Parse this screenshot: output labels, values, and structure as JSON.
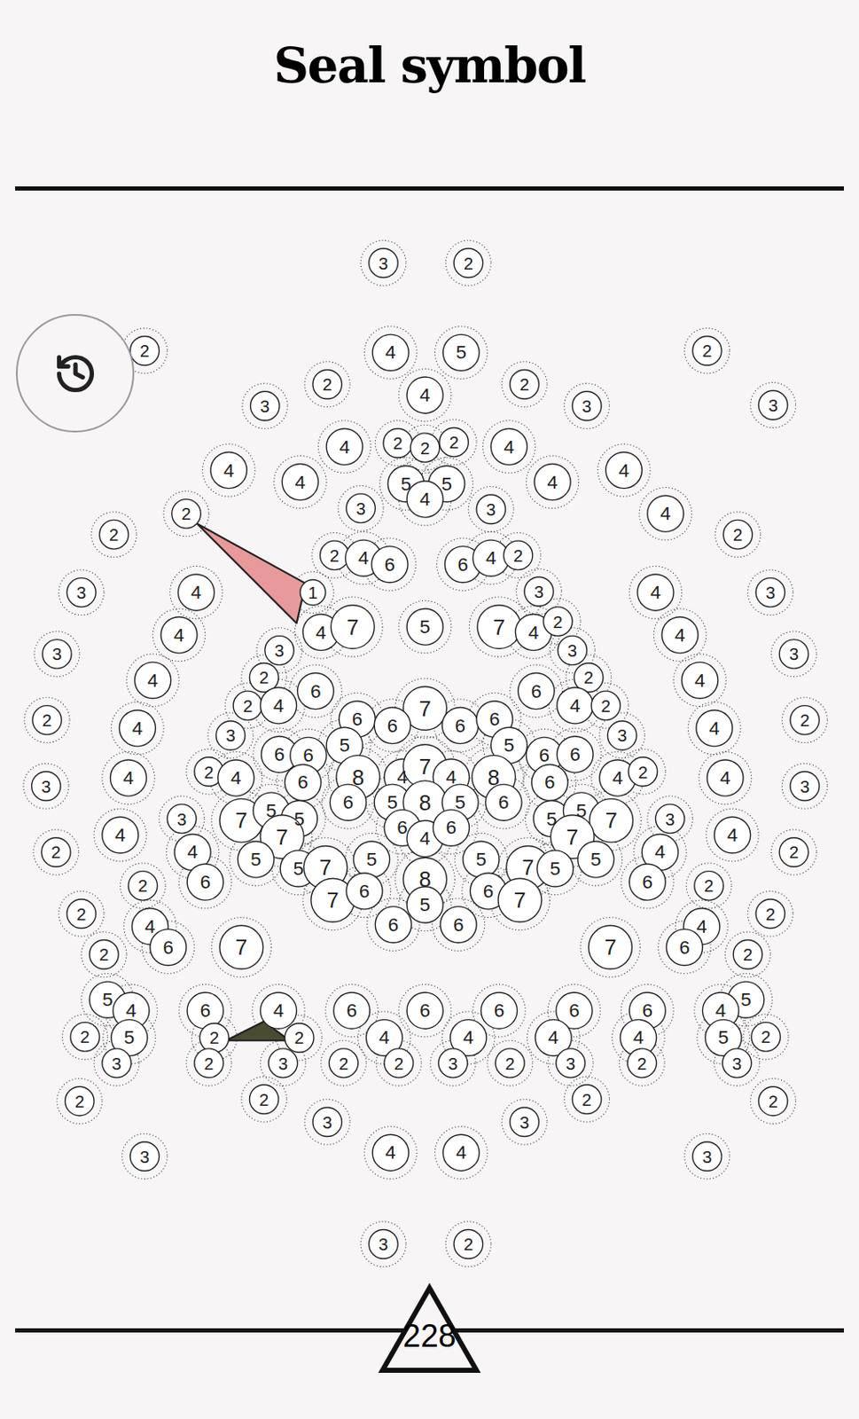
{
  "title": "Seal symbol",
  "score": "228",
  "circles": [
    {
      "value": "3"
    },
    {
      "value": "2"
    },
    {
      "value": "2"
    },
    {
      "value": "4"
    },
    {
      "value": "5"
    },
    {
      "value": "2"
    },
    {
      "value": "3"
    },
    {
      "value": "3"
    },
    {
      "value": "2"
    },
    {
      "value": "4"
    },
    {
      "value": "2"
    },
    {
      "value": "3"
    },
    {
      "value": "3"
    },
    {
      "value": "4"
    },
    {
      "value": "4"
    },
    {
      "value": "4"
    },
    {
      "value": "2"
    },
    {
      "value": "2"
    },
    {
      "value": "2"
    },
    {
      "value": "4"
    },
    {
      "value": "4"
    },
    {
      "value": "4"
    },
    {
      "value": "5"
    },
    {
      "value": "5"
    },
    {
      "value": "4"
    },
    {
      "value": "2"
    },
    {
      "value": "3"
    },
    {
      "value": "3"
    },
    {
      "value": "4"
    },
    {
      "value": "2"
    },
    {
      "value": "2"
    },
    {
      "value": "2"
    },
    {
      "value": "4"
    },
    {
      "value": "6"
    },
    {
      "value": "6"
    },
    {
      "value": "4"
    },
    {
      "value": "2"
    },
    {
      "value": "3"
    },
    {
      "value": "4"
    },
    {
      "value": "1"
    },
    {
      "value": "3"
    },
    {
      "value": "4"
    },
    {
      "value": "3"
    },
    {
      "value": "4"
    },
    {
      "value": "7"
    },
    {
      "value": "5"
    },
    {
      "value": "7"
    },
    {
      "value": "4"
    },
    {
      "value": "2"
    },
    {
      "value": "4"
    },
    {
      "value": "4"
    },
    {
      "value": "3"
    },
    {
      "value": "3"
    },
    {
      "value": "3"
    },
    {
      "value": "3"
    },
    {
      "value": "4"
    },
    {
      "value": "2"
    },
    {
      "value": "6"
    },
    {
      "value": "6"
    },
    {
      "value": "2"
    },
    {
      "value": "4"
    },
    {
      "value": "2"
    },
    {
      "value": "4"
    },
    {
      "value": "4"
    },
    {
      "value": "2"
    },
    {
      "value": "2"
    },
    {
      "value": "7"
    },
    {
      "value": "6"
    },
    {
      "value": "6"
    },
    {
      "value": "6"
    },
    {
      "value": "6"
    },
    {
      "value": "2"
    },
    {
      "value": "4"
    },
    {
      "value": "4"
    },
    {
      "value": "3"
    },
    {
      "value": "5"
    },
    {
      "value": "5"
    },
    {
      "value": "3"
    },
    {
      "value": "6"
    },
    {
      "value": "6"
    },
    {
      "value": "6"
    },
    {
      "value": "6"
    },
    {
      "value": "3"
    },
    {
      "value": "4"
    },
    {
      "value": "2"
    },
    {
      "value": "4"
    },
    {
      "value": "6"
    },
    {
      "value": "8"
    },
    {
      "value": "4"
    },
    {
      "value": "7"
    },
    {
      "value": "4"
    },
    {
      "value": "8"
    },
    {
      "value": "6"
    },
    {
      "value": "4"
    },
    {
      "value": "2"
    },
    {
      "value": "4"
    },
    {
      "value": "3"
    },
    {
      "value": "6"
    },
    {
      "value": "5"
    },
    {
      "value": "8"
    },
    {
      "value": "5"
    },
    {
      "value": "6"
    },
    {
      "value": "3"
    },
    {
      "value": "7"
    },
    {
      "value": "5"
    },
    {
      "value": "5"
    },
    {
      "value": "7"
    },
    {
      "value": "5"
    },
    {
      "value": "5"
    },
    {
      "value": "7"
    },
    {
      "value": "7"
    },
    {
      "value": "3"
    },
    {
      "value": "4"
    },
    {
      "value": "6"
    },
    {
      "value": "4"
    },
    {
      "value": "6"
    },
    {
      "value": "4"
    },
    {
      "value": "2"
    },
    {
      "value": "4"
    },
    {
      "value": "5"
    },
    {
      "value": "5"
    },
    {
      "value": "5"
    },
    {
      "value": "5"
    },
    {
      "value": "4"
    },
    {
      "value": "2"
    },
    {
      "value": "5"
    },
    {
      "value": "7"
    },
    {
      "value": "7"
    },
    {
      "value": "5"
    },
    {
      "value": "6"
    },
    {
      "value": "2"
    },
    {
      "value": "8"
    },
    {
      "value": "6"
    },
    {
      "value": "2"
    },
    {
      "value": "7"
    },
    {
      "value": "6"
    },
    {
      "value": "6"
    },
    {
      "value": "7"
    },
    {
      "value": "5"
    },
    {
      "value": "2"
    },
    {
      "value": "6"
    },
    {
      "value": "6"
    },
    {
      "value": "2"
    },
    {
      "value": "4"
    },
    {
      "value": "4"
    },
    {
      "value": "6"
    },
    {
      "value": "7"
    },
    {
      "value": "7"
    },
    {
      "value": "6"
    },
    {
      "value": "2"
    },
    {
      "value": "2"
    },
    {
      "value": "5"
    },
    {
      "value": "4"
    },
    {
      "value": "5"
    },
    {
      "value": "4"
    },
    {
      "value": "6"
    },
    {
      "value": "4"
    },
    {
      "value": "6"
    },
    {
      "value": "6"
    },
    {
      "value": "6"
    },
    {
      "value": "6"
    },
    {
      "value": "6"
    },
    {
      "value": "2"
    },
    {
      "value": "5"
    },
    {
      "value": "2"
    },
    {
      "value": "2"
    },
    {
      "value": "4"
    },
    {
      "value": "4"
    },
    {
      "value": "4"
    },
    {
      "value": "4"
    },
    {
      "value": "5"
    },
    {
      "value": "2"
    },
    {
      "value": "3"
    },
    {
      "value": "2"
    },
    {
      "value": "3"
    },
    {
      "value": "2"
    },
    {
      "value": "2"
    },
    {
      "value": "3"
    },
    {
      "value": "2"
    },
    {
      "value": "3"
    },
    {
      "value": "2"
    },
    {
      "value": "3"
    },
    {
      "value": "2"
    },
    {
      "value": "2"
    },
    {
      "value": "2"
    },
    {
      "value": "2"
    },
    {
      "value": "3"
    },
    {
      "value": "3"
    },
    {
      "value": "3"
    },
    {
      "value": "4"
    },
    {
      "value": "4"
    },
    {
      "value": "3"
    },
    {
      "value": "3"
    },
    {
      "value": "2"
    }
  ],
  "pieces": [
    {
      "color": "#e89a9a"
    },
    {
      "color": "#4b4a33"
    }
  ]
}
